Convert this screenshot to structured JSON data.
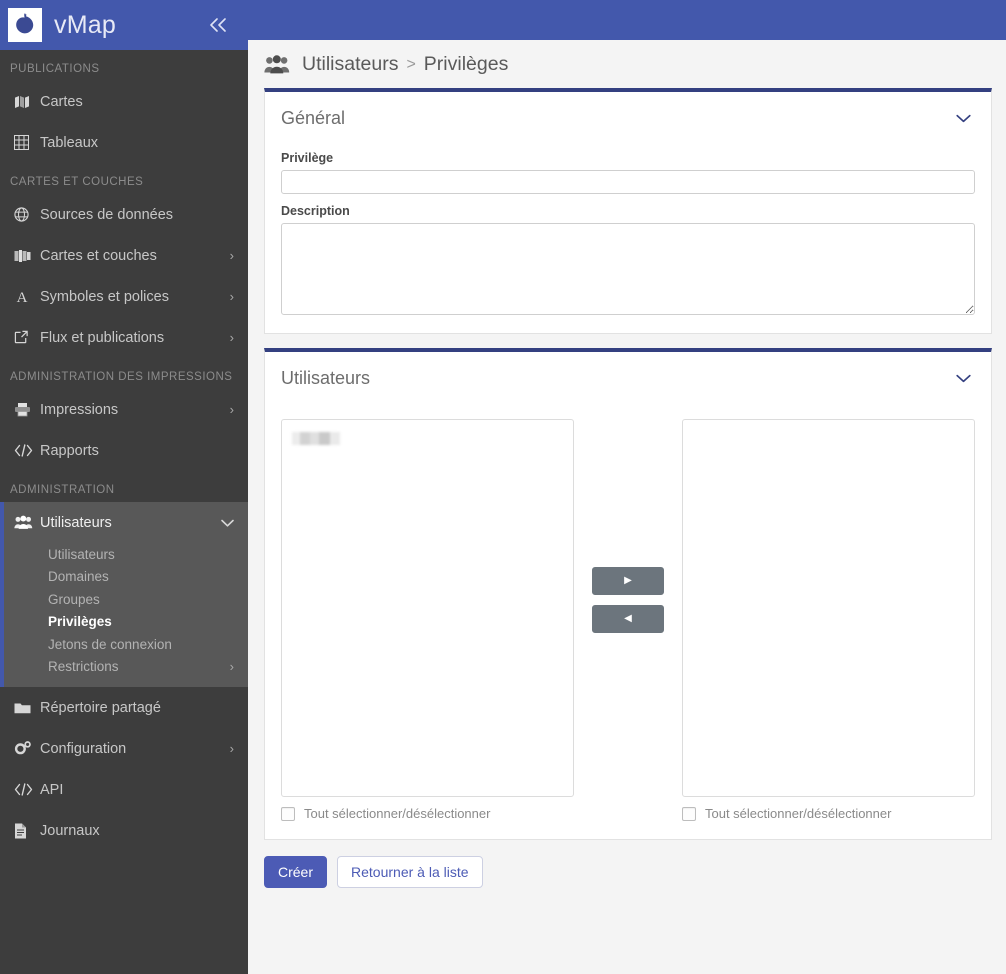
{
  "brand": {
    "title": "vMap",
    "collapse_label": "«",
    "logo_name": "leaf-logo"
  },
  "sidebar": {
    "sections": [
      {
        "label": "PUBLICATIONS",
        "items": [
          {
            "label": "Cartes",
            "icon": "map-icon",
            "caret": ""
          },
          {
            "label": "Tableaux",
            "icon": "table-icon",
            "caret": ""
          }
        ]
      },
      {
        "label": "CARTES ET COUCHES",
        "items": [
          {
            "label": "Sources de données",
            "icon": "globe-icon",
            "caret": ""
          },
          {
            "label": "Cartes et couches",
            "icon": "layers-icon",
            "caret": "›"
          },
          {
            "label": "Symboles et polices",
            "icon": "font-icon",
            "caret": "›"
          },
          {
            "label": "Flux et publications",
            "icon": "external-link-icon",
            "caret": "›"
          }
        ]
      },
      {
        "label": "ADMINISTRATION DES IMPRESSIONS",
        "items": [
          {
            "label": "Impressions",
            "icon": "printer-icon",
            "caret": "›"
          },
          {
            "label": "Rapports",
            "icon": "code-icon",
            "caret": ""
          }
        ]
      },
      {
        "label": "ADMINISTRATION",
        "items": []
      }
    ],
    "users_group": {
      "label": "Utilisateurs",
      "icon": "users-icon",
      "caret": "⌄",
      "children": [
        {
          "label": "Utilisateurs",
          "active": false,
          "caret": ""
        },
        {
          "label": "Domaines",
          "active": false,
          "caret": ""
        },
        {
          "label": "Groupes",
          "active": false,
          "caret": ""
        },
        {
          "label": "Privilèges",
          "active": true,
          "caret": ""
        },
        {
          "label": "Jetons de connexion",
          "active": false,
          "caret": ""
        },
        {
          "label": "Restrictions",
          "active": false,
          "caret": "›"
        }
      ]
    },
    "bottom_items": [
      {
        "label": "Répertoire partagé",
        "icon": "folder-icon",
        "caret": ""
      },
      {
        "label": "Configuration",
        "icon": "gears-icon",
        "caret": "›"
      },
      {
        "label": "API",
        "icon": "code-icon",
        "caret": ""
      },
      {
        "label": "Journaux",
        "icon": "file-icon",
        "caret": ""
      }
    ]
  },
  "breadcrumb": {
    "icon": "users-icon",
    "parent": "Utilisateurs",
    "separator": ">",
    "current": "Privilèges"
  },
  "general_panel": {
    "title": "Général",
    "chevron": "⌄",
    "privilege_label": "Privilège",
    "privilege_value": "",
    "description_label": "Description",
    "description_value": ""
  },
  "users_panel": {
    "title": "Utilisateurs",
    "chevron": "⌄",
    "available_list": {
      "items": [
        {
          "redacted": true
        }
      ],
      "select_all_label": "Tout sélectionner/désélectionner",
      "select_all_checked": false
    },
    "selected_list": {
      "items": [],
      "select_all_label": "Tout sélectionner/désélectionner",
      "select_all_checked": false
    },
    "move_right_label": "▶",
    "move_left_label": "◀"
  },
  "actions": {
    "create_label": "Créer",
    "back_label": "Retourner à la liste"
  },
  "colors": {
    "brand_blue": "#4358ac",
    "panel_border_navy": "#344080",
    "primary_button": "#4c5bb5",
    "sidebar_bg": "#3d3d3d",
    "sidebar_active_bg": "#585858",
    "transfer_button": "#6c757d",
    "content_bg": "#f4f4f4"
  }
}
